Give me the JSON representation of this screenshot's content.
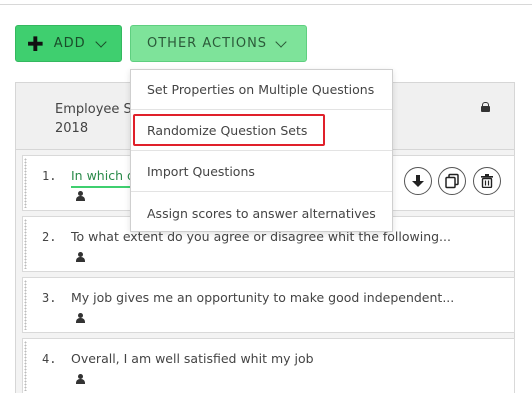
{
  "toolbar": {
    "add_label": "ADD",
    "add_icon": "plus-icon",
    "other_actions_label": "OTHER ACTIONS"
  },
  "survey": {
    "title": "Employee Survey 2018",
    "title_visible_line1": "Employee S",
    "title_visible_line2": "2018",
    "lock_icon": "lock-icon"
  },
  "questions": [
    {
      "number": "1.",
      "text": "In which d"
    },
    {
      "number": "2.",
      "text": "To what extent do you agree or disagree whit the following..."
    },
    {
      "number": "3.",
      "text": "My job gives me an opportunity to make good independent..."
    },
    {
      "number": "4.",
      "text": "Overall, I am well satisfied whit my job"
    }
  ],
  "dropdown": {
    "items": [
      "Set Properties on Multiple Questions",
      "Randomize Question Sets",
      "Import Questions",
      "Assign scores to answer alternatives"
    ],
    "highlighted_index": 1,
    "highlight_color": "#e0202a"
  },
  "colors": {
    "add_button": "#3fcf6f",
    "other_actions_button": "#7ee39a",
    "accent_green": "#2a8a4a"
  }
}
